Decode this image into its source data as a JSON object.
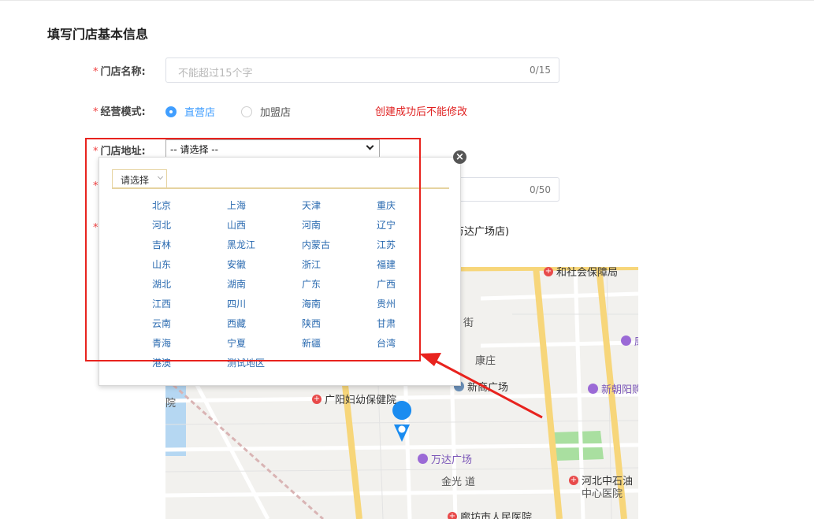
{
  "page": {
    "title": "填写门店基本信息"
  },
  "form": {
    "store_name": {
      "label": "门店名称:",
      "placeholder": "不能超过15个字",
      "count": "0/15"
    },
    "mode": {
      "label": "经营模式:",
      "options": [
        "直营店",
        "加盟店"
      ],
      "selected": "直营店",
      "warning": "创建成功后不能修改"
    },
    "address": {
      "label": "门店地址:",
      "select_value": "-- 请选择 --",
      "detail_count": "0/50",
      "location_text": "万达广场店)"
    }
  },
  "popup": {
    "tab_label": "请选择",
    "provinces": [
      "北京",
      "上海",
      "天津",
      "重庆",
      "河北",
      "山西",
      "河南",
      "辽宁",
      "吉林",
      "黑龙江",
      "内蒙古",
      "江苏",
      "山东",
      "安徽",
      "浙江",
      "福建",
      "湖北",
      "湖南",
      "广东",
      "广西",
      "江西",
      "四川",
      "海南",
      "贵州",
      "云南",
      "西藏",
      "陕西",
      "甘肃",
      "青海",
      "宁夏",
      "新疆",
      "台湾",
      "港澳",
      "测试地区"
    ],
    "close_icon": "close-icon"
  },
  "map": {
    "pois": {
      "social_security": "和社会保障局",
      "jie": "街",
      "kangzhuang": "康庄",
      "xinshang": "新商广场",
      "xinchaoyang": "新朝阳购",
      "guangyang_maternal": "广阳妇幼保健院",
      "yuan": "院",
      "wanda": "万达广场",
      "jinguang": "金光",
      "dao": "道",
      "zhongshiyou_1": "河北中石油",
      "zhongshiyou_2": "中心医院",
      "renmin_hospital": "廊坊市人民医院",
      "kang": "康"
    },
    "colors": {
      "road_major": "#f7d67a",
      "road_minor": "#ffffff",
      "park": "#a9dfa0",
      "water": "#b5d7f2",
      "pin": "#1a8cf0"
    }
  },
  "annotations": {
    "highlight_color": "#e8231e"
  }
}
